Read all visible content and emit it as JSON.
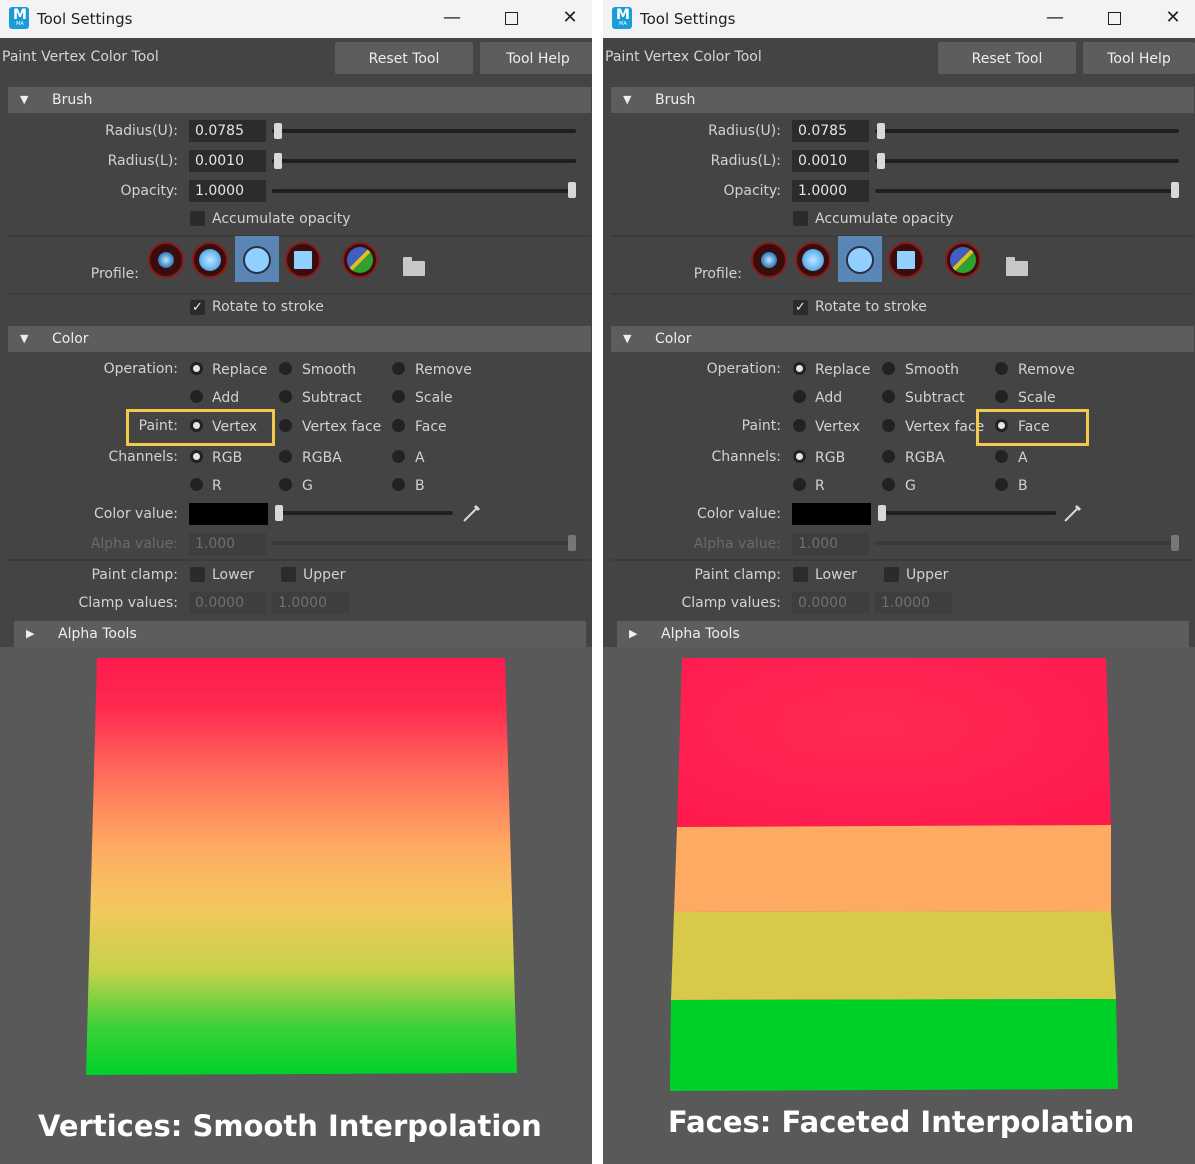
{
  "window_title": "Tool Settings",
  "tool_name": "Paint Vertex Color Tool",
  "reset_tool_label": "Reset Tool",
  "tool_help_label": "Tool Help",
  "icon_letter": "M",
  "icon_sub": "MA",
  "win_minimize": "—",
  "win_close": "✕",
  "brush_section": "Brush",
  "color_section": "Color",
  "alpha_tools_section": "Alpha Tools",
  "brush": {
    "radius_u_label": "Radius(U):",
    "radius_u_value": "0.0785",
    "radius_l_label": "Radius(L):",
    "radius_l_value": "0.0010",
    "opacity_label": "Opacity:",
    "opacity_value": "1.0000",
    "accumulate_label": "Accumulate opacity",
    "profile_label": "Profile:",
    "rotate_label": "Rotate to stroke",
    "rotate_checked": true
  },
  "color": {
    "operation_label": "Operation:",
    "op_replace": "Replace",
    "op_smooth": "Smooth",
    "op_remove": "Remove",
    "op_add": "Add",
    "op_subtract": "Subtract",
    "op_scale": "Scale",
    "paint_label": "Paint:",
    "paint_vertex": "Vertex",
    "paint_vertex_face": "Vertex face",
    "paint_face": "Face",
    "channels_label": "Channels:",
    "ch_rgb": "RGB",
    "ch_rgba": "RGBA",
    "ch_a": "A",
    "ch_r": "R",
    "ch_g": "G",
    "ch_b": "B",
    "color_value_label": "Color value:",
    "color_swatch": "#000000",
    "alpha_value_label": "Alpha value:",
    "alpha_value": "1.000",
    "paint_clamp_label": "Paint clamp:",
    "clamp_lower": "Lower",
    "clamp_upper": "Upper",
    "clamp_values_label": "Clamp values:",
    "clamp_min": "0.0000",
    "clamp_max": "1.0000"
  },
  "left_paint_selected": "Vertex",
  "right_paint_selected": "Face",
  "left_caption": "Vertices: Smooth Interpolation",
  "right_caption": "Faces: Faceted Interpolation",
  "colors": {
    "red": "#ff1a4e",
    "orange": "#ffaa62",
    "yellow": "#d9c94a",
    "green": "#00d128",
    "highlight": "#f2c94c"
  }
}
